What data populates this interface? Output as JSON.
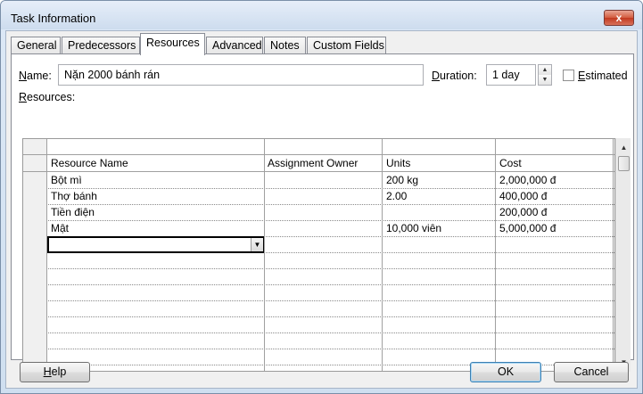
{
  "window": {
    "title": "Task Information",
    "close_glyph": "x"
  },
  "tabs": [
    {
      "label": "General",
      "active": false
    },
    {
      "label": "Predecessors",
      "active": false
    },
    {
      "label": "Resources",
      "active": true
    },
    {
      "label": "Advanced",
      "active": false
    },
    {
      "label": "Notes",
      "active": false
    },
    {
      "label": "Custom Fields",
      "active": false
    }
  ],
  "form": {
    "name_label_accel": "N",
    "name_label_rest": "ame:",
    "name_value": "Nặn 2000 bánh rán",
    "duration_label_accel": "D",
    "duration_label_rest": "uration:",
    "duration_value": "1 day",
    "estimated_label_accel": "E",
    "estimated_label_rest": "stimated",
    "estimated_checked": false,
    "resources_label_accel": "R",
    "resources_label_rest": "esources:"
  },
  "grid": {
    "columns": [
      "Resource Name",
      "Assignment Owner",
      "Units",
      "Cost"
    ],
    "rows": [
      [
        "Bột mì",
        "",
        "200 kg",
        "2,000,000 đ"
      ],
      [
        "Thợ bánh",
        "",
        "2.00",
        "400,000 đ"
      ],
      [
        "Tiền điện",
        "",
        "",
        "200,000 đ"
      ],
      [
        "Mật",
        "",
        "10,000 viên",
        "5,000,000 đ"
      ]
    ],
    "empty_rows": 11
  },
  "buttons": {
    "help_accel": "H",
    "help_rest": "elp",
    "ok": "OK",
    "cancel": "Cancel"
  },
  "colors": {
    "active_cell_border": "#000000",
    "grid_dotted": "#8a8a8a",
    "selection_gray": "#c8c8c8"
  }
}
